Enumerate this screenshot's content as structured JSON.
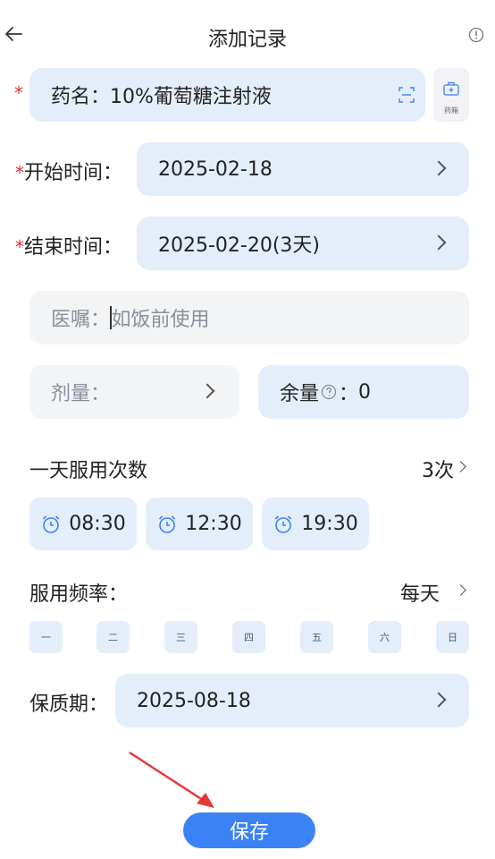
{
  "header": {
    "title": "添加记录"
  },
  "drug": {
    "required_mark": "*",
    "label": "药名：",
    "value": "10%葡萄糖注射液",
    "medbox_label": "药箱"
  },
  "start": {
    "required_mark": "*",
    "label": "开始时间：",
    "value": "2025-02-18"
  },
  "end": {
    "required_mark": "*",
    "label": "结束时间：",
    "value": "2025-02-20(3天)"
  },
  "advice": {
    "label": "医嘱：",
    "placeholder": "如饭前使用"
  },
  "dose": {
    "label": "剂量："
  },
  "remaining": {
    "label": "余量",
    "colon": "：",
    "value": "0"
  },
  "times_per_day": {
    "label": "一天服用次数",
    "value": "3次"
  },
  "times": [
    "08:30",
    "12:30",
    "19:30"
  ],
  "frequency": {
    "label": "服用频率：",
    "value": "每天"
  },
  "weekdays": [
    "一",
    "二",
    "三",
    "四",
    "五",
    "六",
    "日"
  ],
  "shelf_life": {
    "label": "保质期：",
    "value": "2025-08-18"
  },
  "save_label": "保存",
  "colors": {
    "accent": "#3b82f6",
    "field_bg": "#e4eefb",
    "required": "#e03131",
    "arrow": "#e53935"
  }
}
